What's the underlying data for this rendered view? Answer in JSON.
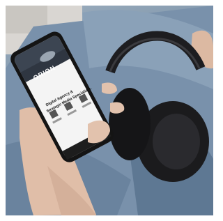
{
  "phone_screen": {
    "brand": "ORION",
    "headline_line1": "Digital Agency &",
    "headline_line2": "Strategic Media Specialists."
  },
  "colors": {
    "jeans": "#6f88a3",
    "headphones": "#1b1b1d",
    "phone": "#141414",
    "skin": "#e3c3ad"
  }
}
